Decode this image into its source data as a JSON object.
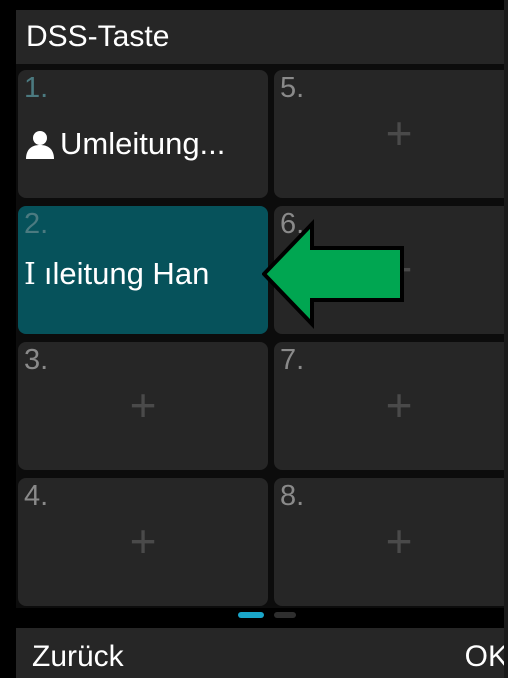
{
  "header": {
    "title": "DSS-Taste"
  },
  "tiles": [
    {
      "number": "1.",
      "label": "Umleitung...",
      "icon": "person-icon"
    },
    {
      "number": "2.",
      "label": "ıleitung Han",
      "caret": "I"
    },
    {
      "number": "3."
    },
    {
      "number": "4."
    },
    {
      "number": "5."
    },
    {
      "number": "6."
    },
    {
      "number": "7."
    },
    {
      "number": "8."
    }
  ],
  "plus_glyph": "+",
  "pagination": {
    "current": 1,
    "total": 2
  },
  "softkeys": {
    "back": "Zurück",
    "ok": "OK"
  },
  "colors": {
    "background": "#000000",
    "tile": "#262626",
    "selected_tile": "#06525b",
    "accent": "#1aa6c9",
    "arrow": "#00a651"
  }
}
